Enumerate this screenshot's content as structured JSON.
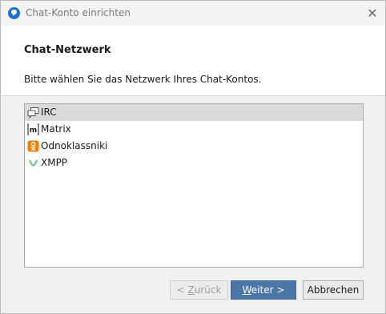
{
  "window": {
    "title": "Chat-Konto einrichten",
    "close_glyph": "✕"
  },
  "header": {
    "heading": "Chat-Netzwerk",
    "description": "Bitte wählen Sie das Netzwerk Ihres Chat-Kontos."
  },
  "networks": [
    {
      "label": "IRC",
      "icon": "irc-icon",
      "selected": true
    },
    {
      "label": "Matrix",
      "icon": "matrix-icon",
      "selected": false
    },
    {
      "label": "Odnoklassniki",
      "icon": "odnoklassniki-icon",
      "selected": false
    },
    {
      "label": "XMPP",
      "icon": "xmpp-icon",
      "selected": false
    }
  ],
  "buttons": {
    "back_prefix": "< ",
    "back_mnemonic": "Z",
    "back_rest": "urück",
    "next_mnemonic": "W",
    "next_rest": "eiter >",
    "cancel": "Abbrechen"
  },
  "colors": {
    "accent": "#4a76a8",
    "selection": "#dadada",
    "odnoklassniki": "#ee8208",
    "xmpp_green": "#3a9a3a"
  }
}
